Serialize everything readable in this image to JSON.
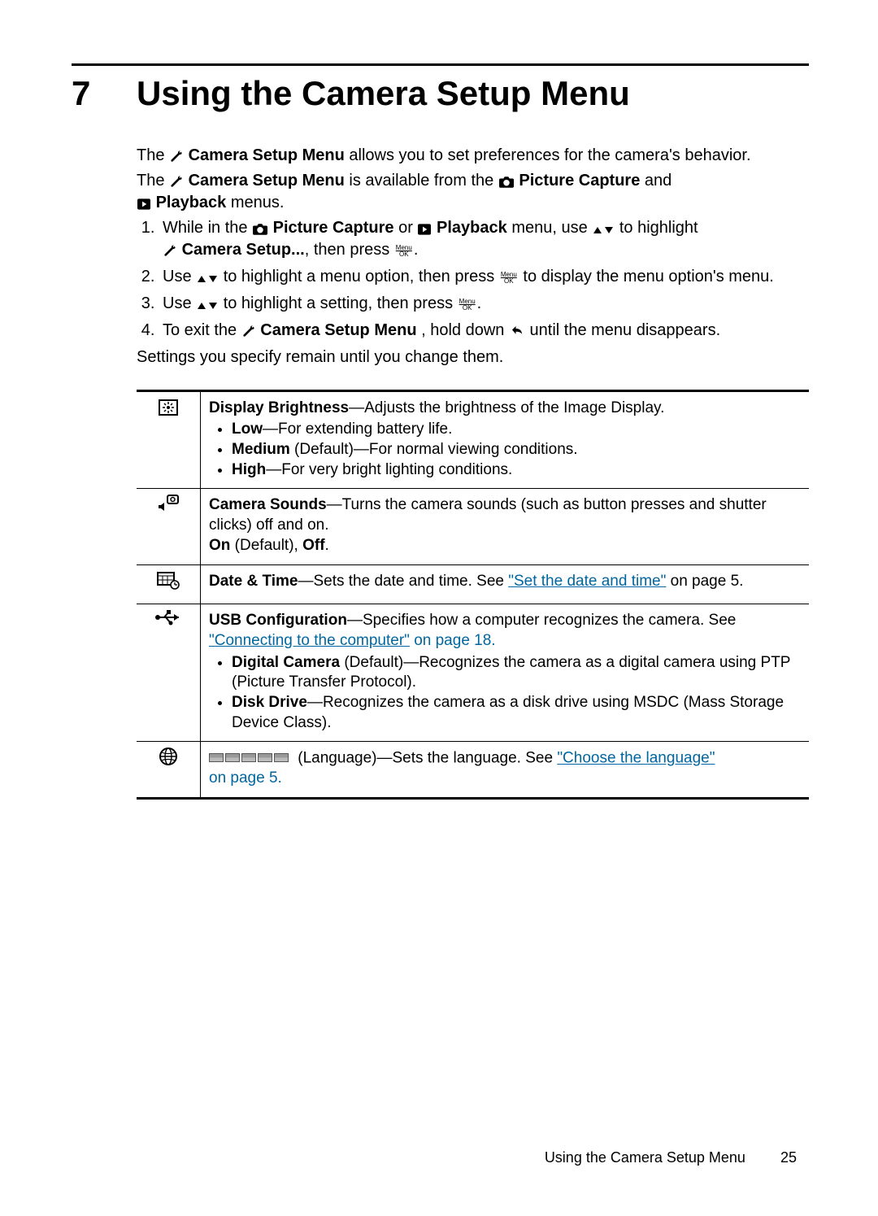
{
  "chapter": {
    "number": "7",
    "title": "Using the Camera Setup Menu"
  },
  "intro": {
    "p1a": "The ",
    "p1b": "Camera Setup Menu",
    "p1c": " allows you to set preferences for the camera's behavior.",
    "p2a": "The ",
    "p2b": "Camera Setup Menu",
    "p2c": " is available from the ",
    "p2d": "Picture Capture",
    "p2e": " and ",
    "p2f": "Playback",
    "p2g": " menus."
  },
  "steps": {
    "s1a": "While in the ",
    "s1b": "Picture Capture",
    "s1c": " or ",
    "s1d": "Playback",
    "s1e": " menu, use ",
    "s1f": " to highlight ",
    "s1g": "Camera Setup...",
    "s1h": ", then press ",
    "s1end": ".",
    "s2a": "Use ",
    "s2b": " to highlight a menu option, then press ",
    "s2c": " to display the menu option's menu.",
    "s3a": "Use ",
    "s3b": " to highlight a setting, then press ",
    "s3end": ".",
    "s4a": "To exit the ",
    "s4b": "Camera Setup Menu",
    "s4c": ", hold down ",
    "s4d": " until the menu disappears."
  },
  "settings_sentence": "Settings you specify remain until you change them.",
  "table": {
    "r1": {
      "title": "Display Brightness",
      "desc": "—Adjusts the brightness of the Image Display.",
      "low_label": "Low",
      "low_desc": "—For extending battery life.",
      "med_label": "Medium",
      "med_default": " (Default)",
      "med_desc": "—For normal viewing conditions.",
      "high_label": "High",
      "high_desc": "—For very bright lighting conditions."
    },
    "r2": {
      "title": "Camera Sounds",
      "desc": "—Turns the camera sounds (such as button presses and shutter clicks) off and on.",
      "on_label": "On",
      "on_default": " (Default), ",
      "off_label": "Off",
      "period": "."
    },
    "r3": {
      "title": "Date & Time",
      "desc_a": "—Sets the date and time. See ",
      "link": "\"Set the date and time\"",
      "desc_b": " on page 5."
    },
    "r4": {
      "title": "USB Configuration",
      "desc_a": "—Specifies how a computer recognizes the camera. See ",
      "link": "\"Connecting to the computer\"",
      "desc_b": " on page 18.",
      "dc_label": "Digital Camera",
      "dc_default": "  (Default)",
      "dc_desc": "—Recognizes the camera as a digital camera using PTP (Picture Transfer Protocol).",
      "dd_label": "Disk Drive",
      "dd_desc": "—Recognizes the camera as a disk drive using MSDC (Mass Storage Device Class)."
    },
    "r5": {
      "lang_word": " (Language)",
      "desc_a": "—Sets the language. See ",
      "link": "\"Choose the language\"",
      "desc_b": "on page 5."
    }
  },
  "footer": {
    "section": "Using the Camera Setup Menu",
    "page": "25"
  }
}
